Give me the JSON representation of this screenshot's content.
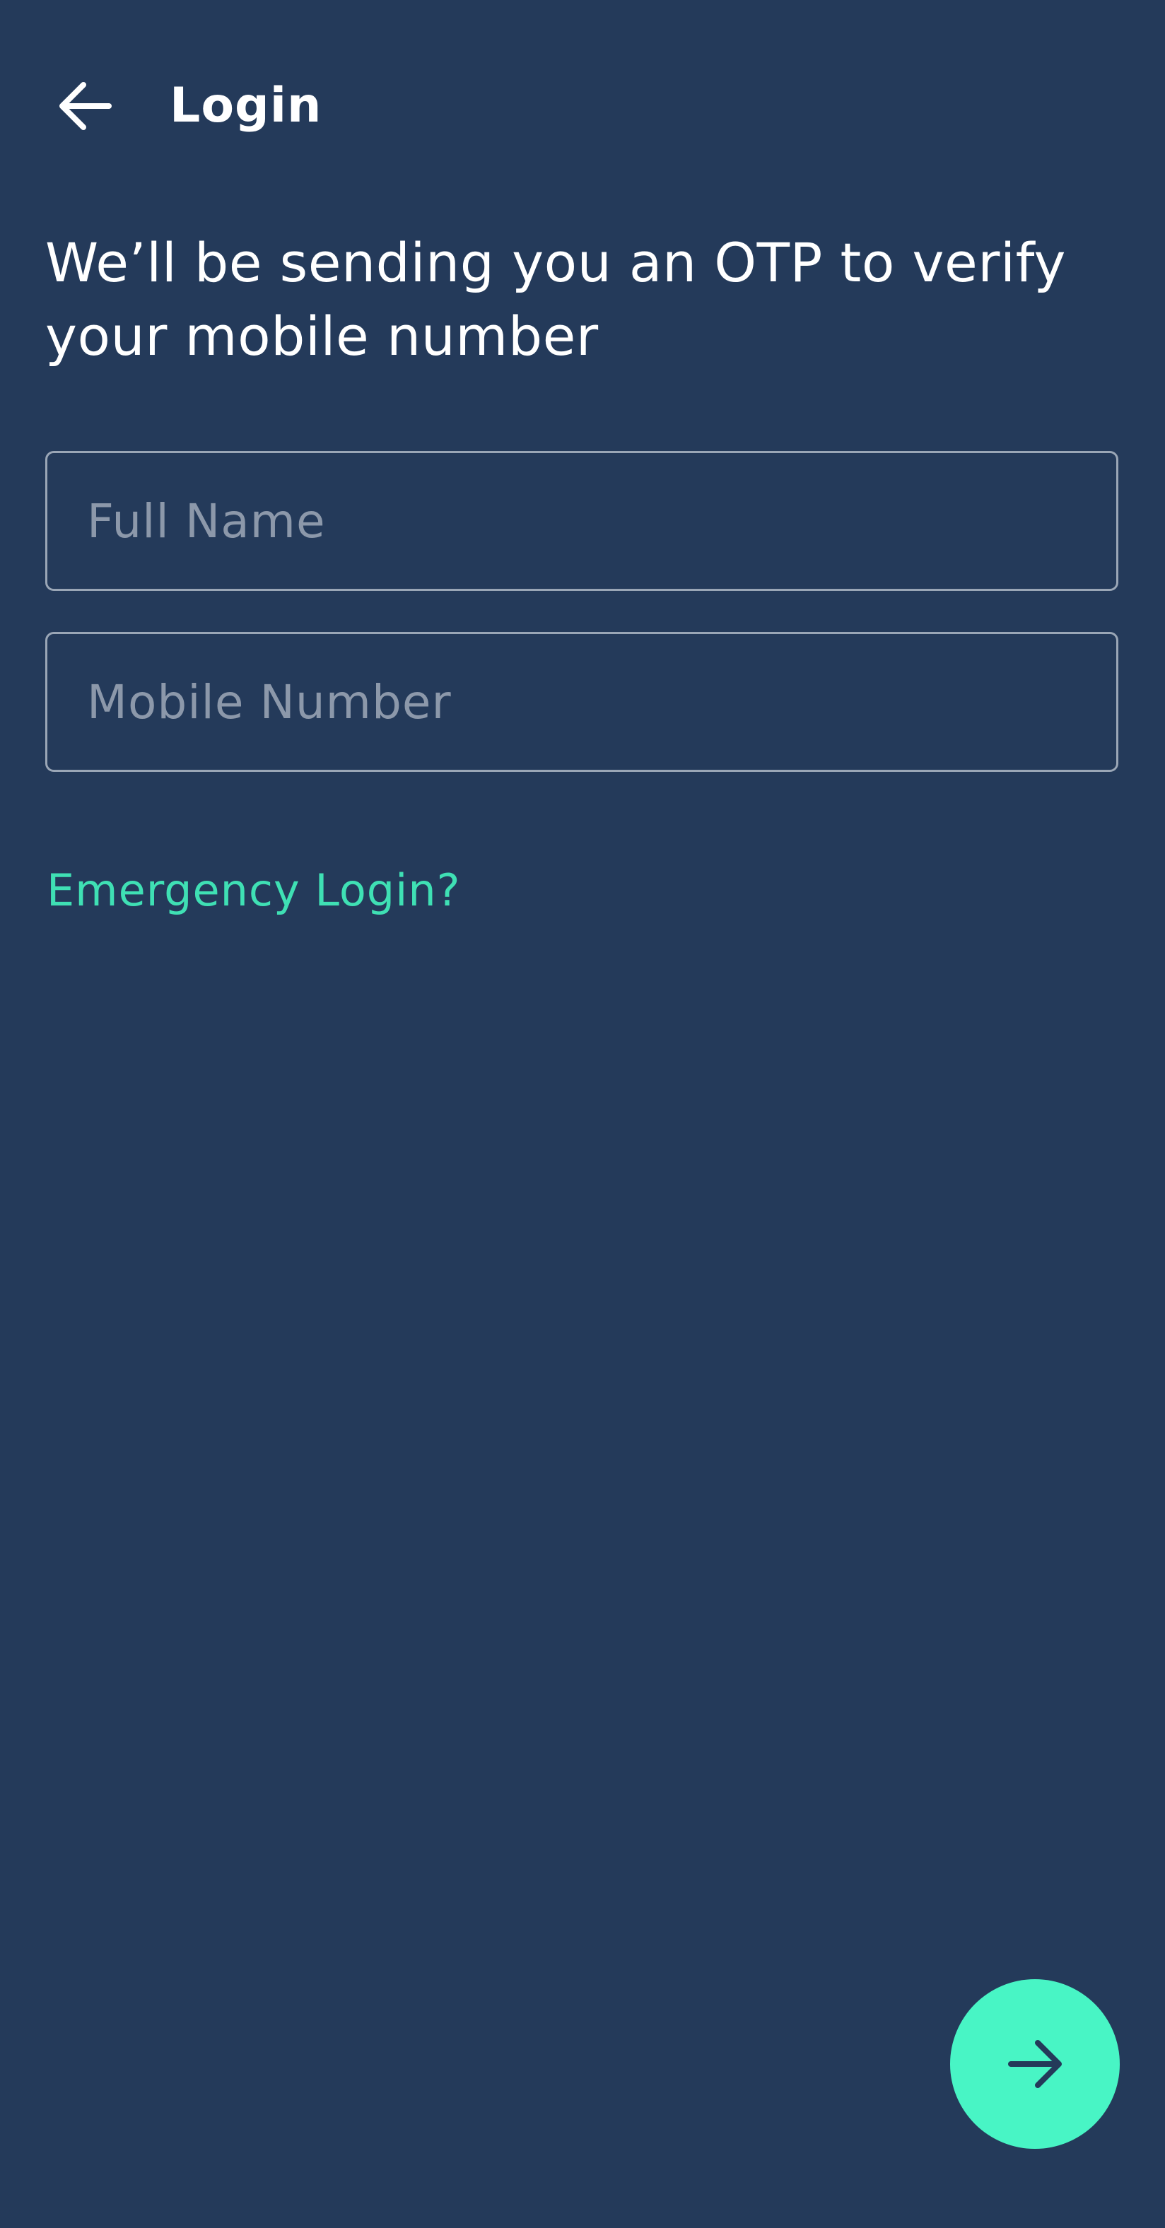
{
  "header": {
    "title": "Login",
    "back_icon": "arrow-left-icon"
  },
  "intro": {
    "text": "We’ll be sending you an OTP to verify your mobile number"
  },
  "form": {
    "full_name": {
      "placeholder": "Full Name",
      "value": ""
    },
    "mobile_number": {
      "placeholder": "Mobile Number",
      "value": ""
    }
  },
  "emergency_link": {
    "label": "Emergency Login?"
  },
  "fab": {
    "icon": "arrow-right-icon"
  },
  "colors": {
    "background": "#243a5a",
    "accent": "#48f5c5",
    "link": "#3fe0b4",
    "text": "#ffffff",
    "placeholder": "#8c98aa",
    "field_border": "#9aa6b6"
  }
}
